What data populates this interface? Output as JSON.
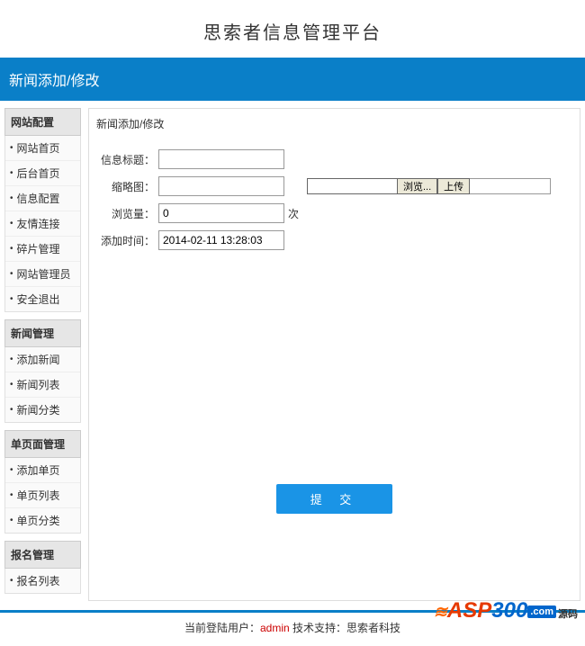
{
  "header": {
    "title": "思索者信息管理平台"
  },
  "titleBar": {
    "text": "新闻添加/修改"
  },
  "sidebar": {
    "groups": [
      {
        "header": "网站配置",
        "items": [
          "网站首页",
          "后台首页",
          "信息配置",
          "友情连接",
          "碎片管理",
          "网站管理员",
          "安全退出"
        ]
      },
      {
        "header": "新闻管理",
        "items": [
          "添加新闻",
          "新闻列表",
          "新闻分类"
        ]
      },
      {
        "header": "单页面管理",
        "items": [
          "添加单页",
          "单页列表",
          "单页分类"
        ]
      },
      {
        "header": "报名管理",
        "items": [
          "报名列表"
        ]
      }
    ]
  },
  "main": {
    "breadcrumb": "新闻添加/修改",
    "fields": {
      "title_label": "信息标题：",
      "thumb_label": "缩略图：",
      "views_label": "浏览量：",
      "views_value": "0",
      "views_suffix": "次",
      "addtime_label": "添加时间：",
      "addtime_value": "2014-02-11 13:28:03",
      "browse_btn": "浏览...",
      "upload_btn": "上传",
      "submit_btn": "提 交"
    }
  },
  "footer": {
    "prefix": "当前登陆用户：",
    "user": "admin",
    "support_label": " 技术支持：",
    "support_name": "思索者科技"
  },
  "watermark": {
    "asp": "ASP",
    "d300": "300",
    "com": ".com",
    "cn": "源码"
  }
}
